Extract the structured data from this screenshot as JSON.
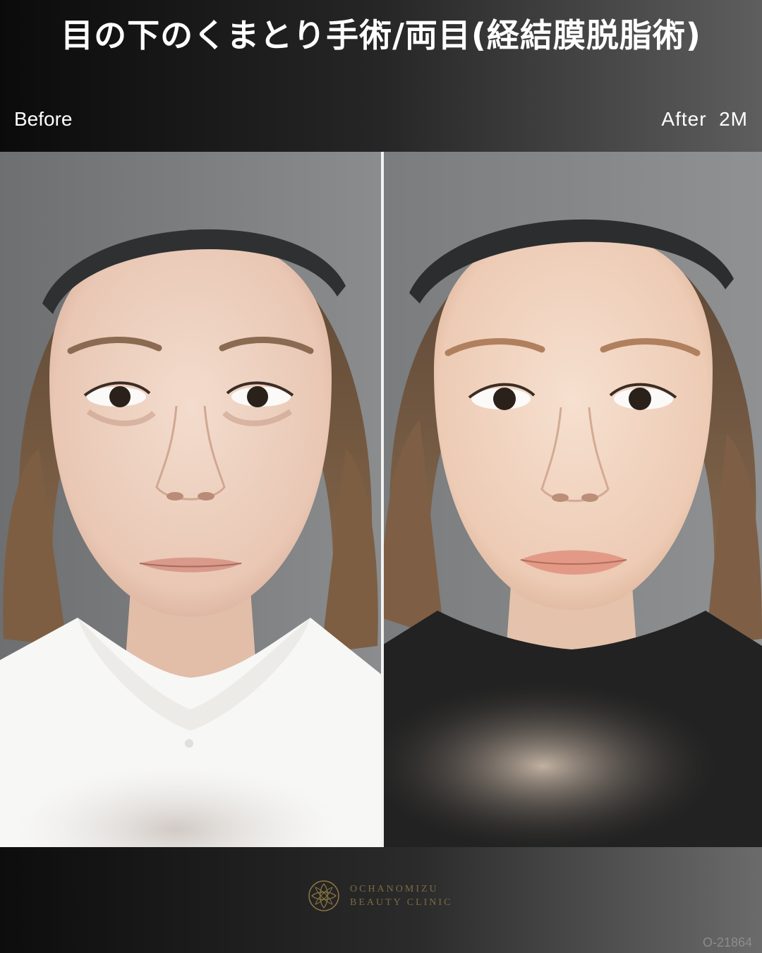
{
  "title": "目の下のくまとり手術/両目(経結膜脱脂術)",
  "labels": {
    "before": "Before",
    "after": "After  2M"
  },
  "brand": {
    "line1": "OCHANOMIZU",
    "line2": "BEAUTY CLINIC"
  },
  "case_code": "O-21864",
  "colors": {
    "accent_gold": "#8a7440"
  }
}
